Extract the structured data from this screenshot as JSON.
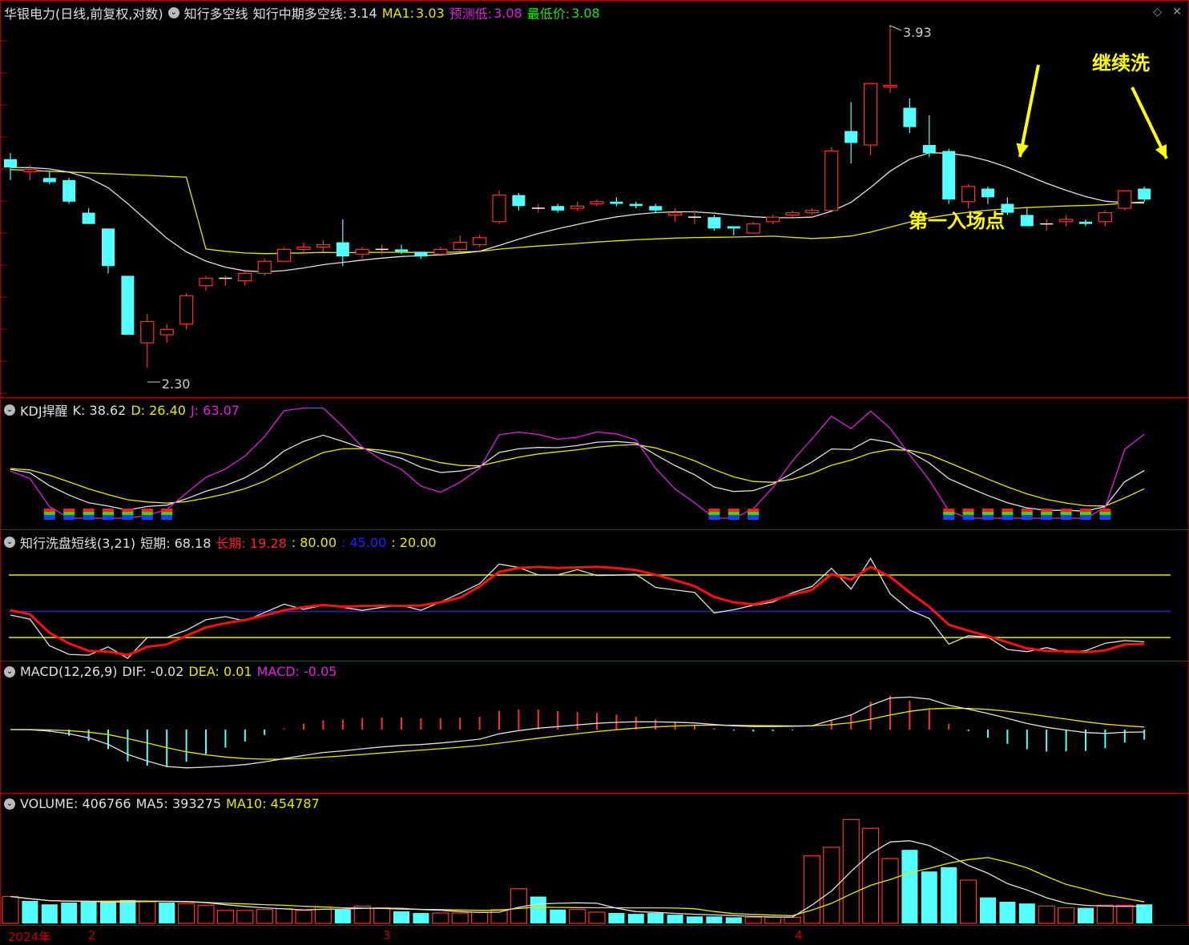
{
  "main": {
    "stock": "华银电力(日线,前复权,对数)",
    "indicator": "知行多空线",
    "mid_label": "知行中期多空线:",
    "mid_value": "3.14",
    "ma1_label": "MA1:",
    "ma1_value": "3.03",
    "pred_label": "预测低:",
    "pred_value": "3.08",
    "low_label": "最低价:",
    "low_value": "3.08",
    "high_mark": "3.93",
    "low_mark": "2.30",
    "annotation_entry": "第一入场点",
    "annotation_wash": "继续洗"
  },
  "kdj": {
    "name": "KDJ捍醒",
    "k": "K: 38.62",
    "d": "D: 26.40",
    "j": "J: 63.07"
  },
  "wash": {
    "name": "知行洗盘短线(3,21)",
    "short": "短期: 68.18",
    "long": "长期: 19.28",
    "l80": ": 80.00",
    "l45": ": 45.00",
    "l20": ": 20.00"
  },
  "macd": {
    "name": "MACD(12,26,9)",
    "dif": "DIF: -0.02",
    "dea": "DEA: 0.01",
    "macd": "MACD: -0.05"
  },
  "volume": {
    "name": "VOLUME: 406766",
    "ma5": "MA5: 393275",
    "ma10": "MA10: 454787"
  },
  "xaxis": {
    "year": "2024年",
    "m2": "2",
    "m3": "3",
    "m4": "4"
  },
  "colors": {
    "up": "#ff3030",
    "down": "#54ffff",
    "yellow": "#e8e800",
    "white": "#e0e0e0",
    "magenta": "#e020e0"
  },
  "candles": [
    [
      3.22,
      3.25,
      3.12,
      3.18
    ],
    [
      3.16,
      3.19,
      3.12,
      3.17
    ],
    [
      3.13,
      3.16,
      3.1,
      3.11
    ],
    [
      3.12,
      3.13,
      3.01,
      3.02
    ],
    [
      2.97,
      2.99,
      2.92,
      2.92
    ],
    [
      2.9,
      2.9,
      2.71,
      2.74
    ],
    [
      2.7,
      2.7,
      2.47,
      2.47
    ],
    [
      2.44,
      2.55,
      2.35,
      2.52
    ],
    [
      2.47,
      2.51,
      2.44,
      2.49
    ],
    [
      2.51,
      2.63,
      2.49,
      2.62
    ],
    [
      2.66,
      2.7,
      2.64,
      2.69
    ],
    [
      2.69,
      2.7,
      2.66,
      2.69
    ],
    [
      2.68,
      2.72,
      2.66,
      2.71
    ],
    [
      2.71,
      2.77,
      2.7,
      2.76
    ],
    [
      2.76,
      2.82,
      2.76,
      2.81
    ],
    [
      2.81,
      2.84,
      2.79,
      2.82
    ],
    [
      2.82,
      2.85,
      2.8,
      2.83
    ],
    [
      2.84,
      2.94,
      2.74,
      2.78
    ],
    [
      2.79,
      2.82,
      2.77,
      2.81
    ],
    [
      2.81,
      2.83,
      2.79,
      2.81
    ],
    [
      2.81,
      2.83,
      2.79,
      2.8
    ],
    [
      2.8,
      2.8,
      2.77,
      2.78
    ],
    [
      2.79,
      2.82,
      2.78,
      2.81
    ],
    [
      2.81,
      2.87,
      2.8,
      2.84
    ],
    [
      2.83,
      2.87,
      2.82,
      2.86
    ],
    [
      2.93,
      3.07,
      2.92,
      3.05
    ],
    [
      3.05,
      3.06,
      2.98,
      3.0
    ],
    [
      2.99,
      3.01,
      2.97,
      2.99
    ],
    [
      3.0,
      3.01,
      2.97,
      2.98
    ],
    [
      2.99,
      3.02,
      2.98,
      3.0
    ],
    [
      3.01,
      3.03,
      3.0,
      3.02
    ],
    [
      3.02,
      3.04,
      3.0,
      3.01
    ],
    [
      3.01,
      3.02,
      2.99,
      3.0
    ],
    [
      3.0,
      3.01,
      2.97,
      2.98
    ],
    [
      2.96,
      2.99,
      2.93,
      2.97
    ],
    [
      2.95,
      2.98,
      2.92,
      2.95
    ],
    [
      2.95,
      2.96,
      2.89,
      2.9
    ],
    [
      2.91,
      2.91,
      2.87,
      2.9
    ],
    [
      2.88,
      2.93,
      2.88,
      2.92
    ],
    [
      2.93,
      2.96,
      2.92,
      2.95
    ],
    [
      2.96,
      2.98,
      2.95,
      2.97
    ],
    [
      2.97,
      2.99,
      2.96,
      2.98
    ],
    [
      2.98,
      3.28,
      2.98,
      3.26
    ],
    [
      3.36,
      3.51,
      3.2,
      3.3
    ],
    [
      3.29,
      3.61,
      3.24,
      3.61
    ],
    [
      3.59,
      3.93,
      3.56,
      3.6
    ],
    [
      3.48,
      3.53,
      3.35,
      3.38
    ],
    [
      3.29,
      3.44,
      3.23,
      3.25
    ],
    [
      3.26,
      3.27,
      3.01,
      3.03
    ],
    [
      3.02,
      3.1,
      2.99,
      3.09
    ],
    [
      3.08,
      3.09,
      3.01,
      3.04
    ],
    [
      3.01,
      3.04,
      2.96,
      2.97
    ],
    [
      2.96,
      2.99,
      2.91,
      2.91
    ],
    [
      2.92,
      2.94,
      2.89,
      2.92
    ],
    [
      2.93,
      2.96,
      2.91,
      2.94
    ],
    [
      2.93,
      2.94,
      2.91,
      2.92
    ],
    [
      2.93,
      2.98,
      2.91,
      2.97
    ],
    [
      2.99,
      3.07,
      2.98,
      3.07
    ],
    [
      3.08,
      3.09,
      3.02,
      3.03
    ]
  ],
  "volumes": [
    310,
    260,
    220,
    240,
    250,
    260,
    270,
    250,
    240,
    230,
    210,
    150,
    150,
    160,
    170,
    150,
    190,
    160,
    200,
    180,
    140,
    120,
    120,
    120,
    130,
    160,
    400,
    310,
    160,
    160,
    130,
    120,
    110,
    120,
    100,
    80,
    80,
    70,
    70,
    70,
    70,
    780,
    880,
    1200,
    1100,
    750,
    850,
    600,
    650,
    500,
    300,
    250,
    230,
    200,
    180,
    180,
    210,
    210,
    220
  ],
  "vol_up": [
    true,
    false,
    false,
    false,
    false,
    false,
    false,
    true,
    false,
    true,
    true,
    true,
    true,
    true,
    true,
    true,
    true,
    false,
    true,
    true,
    false,
    false,
    true,
    true,
    true,
    true,
    true,
    false,
    false,
    true,
    true,
    false,
    false,
    false,
    false,
    false,
    false,
    false,
    true,
    true,
    true,
    true,
    true,
    true,
    true,
    true,
    false,
    false,
    false,
    true,
    false,
    false,
    false,
    true,
    true,
    false,
    true,
    true,
    false
  ]
}
